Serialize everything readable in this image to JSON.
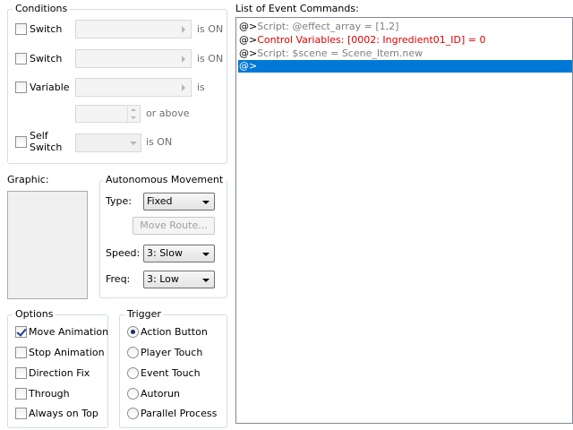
{
  "conditions": {
    "title": "Conditions",
    "switch1": {
      "label": "Switch",
      "suffix": "is ON"
    },
    "switch2": {
      "label": "Switch",
      "suffix": "is ON"
    },
    "variable": {
      "label": "Variable",
      "suffix": "is",
      "or_above": "or above"
    },
    "self_switch": {
      "label_line1": "Self",
      "label_line2": "Switch",
      "suffix": "is ON"
    }
  },
  "graphic": {
    "label": "Graphic:"
  },
  "autonomous": {
    "title": "Autonomous Movement",
    "type_label": "Type:",
    "type_value": "Fixed",
    "move_route_label": "Move Route...",
    "speed_label": "Speed:",
    "speed_value": "3: Slow",
    "freq_label": "Freq:",
    "freq_value": "3: Low"
  },
  "options": {
    "title": "Options",
    "items": [
      {
        "label": "Move Animation",
        "checked": true
      },
      {
        "label": "Stop Animation",
        "checked": false
      },
      {
        "label": "Direction Fix",
        "checked": false
      },
      {
        "label": "Through",
        "checked": false
      },
      {
        "label": "Always on Top",
        "checked": false
      }
    ]
  },
  "trigger": {
    "title": "Trigger",
    "items": [
      {
        "label": "Action Button",
        "selected": true
      },
      {
        "label": "Player Touch",
        "selected": false
      },
      {
        "label": "Event Touch",
        "selected": false
      },
      {
        "label": "Autorun",
        "selected": false
      },
      {
        "label": "Parallel Process",
        "selected": false
      }
    ]
  },
  "commands": {
    "title": "List of Event Commands:",
    "rows": [
      {
        "prefix": "@>",
        "text": "Script: @effect_array = [1,2]",
        "style": "script"
      },
      {
        "prefix": "@>",
        "text": "Control Variables: [0002: Ingredient01_ID] = 0",
        "style": "red"
      },
      {
        "prefix": "@>",
        "text": "Script: $scene = Scene_Item.new",
        "style": "script"
      },
      {
        "prefix": "@>",
        "text": "",
        "style": "sel"
      }
    ]
  },
  "colors": {
    "selection": "#0078d7",
    "command_red": "#e00000",
    "script_gray": "#808080",
    "group_border": "#d5dfe5"
  }
}
